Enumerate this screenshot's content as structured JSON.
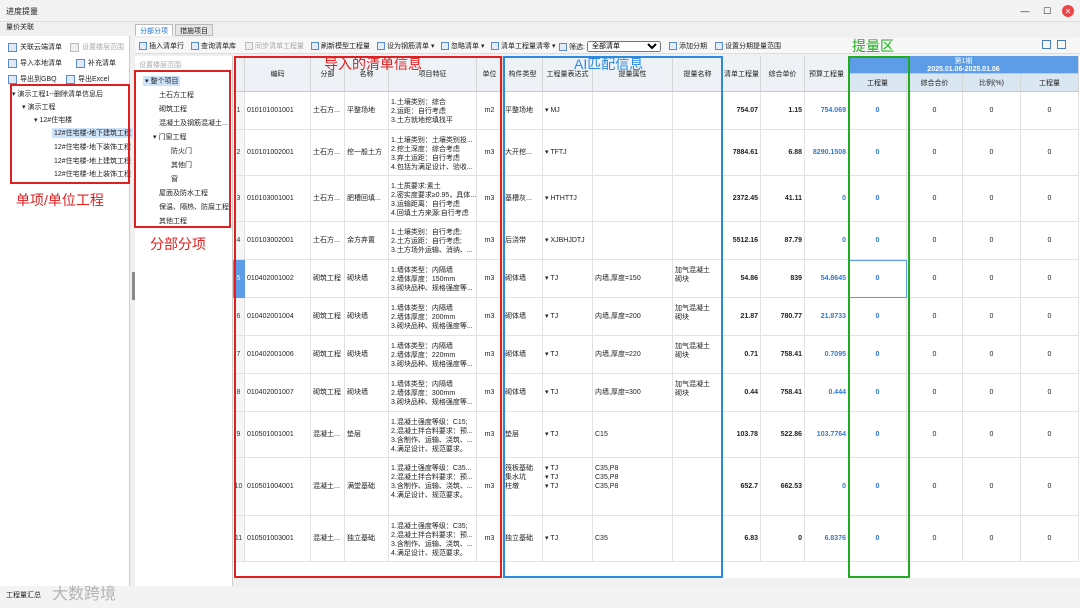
{
  "window": {
    "title": "进度提量",
    "subtitle": "量价关联"
  },
  "tabs": [
    {
      "label": "分部分项"
    },
    {
      "label": "措施项目"
    }
  ],
  "left_buttons": [
    {
      "label": "关联云端清单"
    },
    {
      "label": "设置楼层范围"
    },
    {
      "label": "导入本地清单"
    },
    {
      "label": "补充清单"
    },
    {
      "label": "导出到GBQ"
    },
    {
      "label": "导出Excel"
    }
  ],
  "project_tree": [
    {
      "label": "演示工程1--删除清单信息后"
    },
    {
      "label": "演示工程"
    },
    {
      "label": "12#住宅楼"
    },
    {
      "label": "12#住宅楼-地下建筑工程"
    },
    {
      "label": "12#住宅楼-地下装饰工程"
    },
    {
      "label": "12#住宅楼-地上建筑工程"
    },
    {
      "label": "12#住宅楼-地上装饰工程"
    }
  ],
  "toolbar": {
    "insert_list_row": "插入清单行",
    "query_list_lib": "查询清单库",
    "sync_list_qty": "同步清单工程量",
    "refresh_model_qty": "刷新模型工程量",
    "set_rebar_list": "设为钢筋清单",
    "ignore_list": "忽略清单",
    "list_qty_clear": "清单工程量清零",
    "filter_label": "筛选:",
    "filter_value": "全部清单",
    "add_period": "添加分期",
    "set_period_range": "设置分期提量范围",
    "floor_range": "设置楼层范围"
  },
  "section_tree": [
    {
      "label": "整个项目"
    },
    {
      "label": "土石方工程"
    },
    {
      "label": "砌筑工程"
    },
    {
      "label": "混凝土及钢筋混凝土..."
    },
    {
      "label": "门窗工程"
    },
    {
      "label": "防火门"
    },
    {
      "label": "其他门"
    },
    {
      "label": "窗"
    },
    {
      "label": "屋面及防水工程"
    },
    {
      "label": "保温、隔热、防腐工程"
    },
    {
      "label": "其他工程"
    }
  ],
  "columns": {
    "code": "编码",
    "division": "分部",
    "name": "名称",
    "features": "项目特征",
    "unit": "单位",
    "component_type": "构件类型",
    "expression": "工程量表达式",
    "attribute": "提量属性",
    "attr_name": "提量名称",
    "list_qty": "清单工程量",
    "unit_price": "综合单价",
    "budget_qty": "预算工程量",
    "period_title": "第1期",
    "period_range": "2025.01.06-2025.01.06",
    "period_qty": "工程量",
    "period_total": "综合合价",
    "period_ratio": "比例(%)",
    "period_qty2": "工程量"
  },
  "rows": [
    {
      "no": "1",
      "code": "010101001001",
      "division": "土石方...",
      "name": "平整场地",
      "features": "1.土壤类别：综合\n2.运距：自行考虑\n3.土方就地挖填找平",
      "unit": "m2",
      "ctype": "平整场地",
      "expr": "MJ",
      "attr": "",
      "attrname": "",
      "list_qty": "754.07",
      "price": "1.15",
      "budget": "754.069",
      "pqty": "0",
      "ptotal": "0",
      "pratio": "0",
      "pqty2": "0"
    },
    {
      "no": "2",
      "code": "010101002001",
      "division": "土石方...",
      "name": "挖一般土方",
      "features": "1.土壤类别：土壤类别投...\n2.挖土深度：综合考虑\n3.弃土运距：自行考虑\n4.包括为满足设计、验收...",
      "unit": "m3",
      "ctype": "大开挖...",
      "expr": "TFTJ",
      "attr": "",
      "attrname": "",
      "list_qty": "7884.61",
      "price": "6.88",
      "budget": "8290.1508",
      "pqty": "0",
      "ptotal": "0",
      "pratio": "0",
      "pqty2": "0"
    },
    {
      "no": "3",
      "code": "010103001001",
      "division": "土石方...",
      "name": "肥槽回填...",
      "features": "1.土质要求:素土\n2.密实度要求≥0.95，具体...\n3.运输距离：自行考虑\n4.回填土方来源:自行考虑",
      "unit": "m3",
      "ctype": "基槽灰...",
      "expr": "HTHTTJ",
      "attr": "",
      "attrname": "",
      "list_qty": "2372.45",
      "price": "41.11",
      "budget": "0",
      "pqty": "0",
      "ptotal": "0",
      "pratio": "0",
      "pqty2": "0"
    },
    {
      "no": "4",
      "code": "010103002001",
      "division": "土石方...",
      "name": "余方弃置",
      "features": "1.土壤类别：自行考虑;\n2.土方运距：自行考虑;\n3.土方场外运输、消纳、...",
      "unit": "m3",
      "ctype": "后浇带",
      "expr": "XJBHJDTJ",
      "attr": "",
      "attrname": "",
      "list_qty": "5512.16",
      "price": "87.79",
      "budget": "0",
      "pqty": "0",
      "ptotal": "0",
      "pratio": "0",
      "pqty2": "0"
    },
    {
      "no": "5",
      "code": "010402001002",
      "division": "砌筑工程",
      "name": "砌块墙",
      "features": "1.墙体类型：内隔墙\n2.墙体厚度：150mm\n3.砌块品种、规格强度等...",
      "unit": "m3",
      "ctype": "砌体墙",
      "expr": "TJ",
      "attr": "内墙,厚度=150",
      "attrname": "加气混凝土\n砌块",
      "list_qty": "54.86",
      "price": "839",
      "budget": "54.8645",
      "pqty": "0",
      "ptotal": "0",
      "pratio": "0",
      "pqty2": "0"
    },
    {
      "no": "6",
      "code": "010402001004",
      "division": "砌筑工程",
      "name": "砌块墙",
      "features": "1.墙体类型：内隔墙\n2.墙体厚度：200mm\n3.砌块品种、规格强度等...",
      "unit": "m3",
      "ctype": "砌体墙",
      "expr": "TJ",
      "attr": "内墙,厚度=200",
      "attrname": "加气混凝土\n砌块",
      "list_qty": "21.87",
      "price": "780.77",
      "budget": "21.8733",
      "pqty": "0",
      "ptotal": "0",
      "pratio": "0",
      "pqty2": "0"
    },
    {
      "no": "7",
      "code": "010402001006",
      "division": "砌筑工程",
      "name": "砌块墙",
      "features": "1.墙体类型：内隔墙\n2.墙体厚度：220mm\n3.砌块品种、规格强度等...",
      "unit": "m3",
      "ctype": "砌体墙",
      "expr": "TJ",
      "attr": "内墙,厚度=220",
      "attrname": "加气混凝土\n砌块",
      "list_qty": "0.71",
      "price": "758.41",
      "budget": "0.7095",
      "pqty": "0",
      "ptotal": "0",
      "pratio": "0",
      "pqty2": "0"
    },
    {
      "no": "8",
      "code": "010402001007",
      "division": "砌筑工程",
      "name": "砌块墙",
      "features": "1.墙体类型：内隔墙\n2.墙体厚度：300mm\n3.砌块品种、规格强度等...",
      "unit": "m3",
      "ctype": "砌体墙",
      "expr": "TJ",
      "attr": "内墙,厚度=300",
      "attrname": "加气混凝土\n砌块",
      "list_qty": "0.44",
      "price": "758.41",
      "budget": "0.444",
      "pqty": "0",
      "ptotal": "0",
      "pratio": "0",
      "pqty2": "0"
    },
    {
      "no": "9",
      "code": "010501001001",
      "division": "混凝土...",
      "name": "垫层",
      "features": "1.混凝土强度等级：C15;\n2.混凝土拌合料要求：预...\n3.含制作、运输、浇筑、...\n4.满足设计、规范要求。",
      "unit": "m3",
      "ctype": "垫层",
      "expr": "TJ",
      "attr": "C15",
      "attrname": "",
      "list_qty": "103.78",
      "price": "522.86",
      "budget": "103.7764",
      "pqty": "0",
      "ptotal": "0",
      "pratio": "0",
      "pqty2": "0"
    },
    {
      "no": "10",
      "code": "010501004001",
      "division": "混凝土...",
      "name": "满堂基础",
      "features": "1.混凝土强度等级：C35...\n2.混凝土拌合料要求：预...\n3.含制作、运输、浇筑、...\n4.满足设计、规范要求。",
      "unit": "m3",
      "ctype": "筏板基础\n集水坑\n柱墩",
      "expr": "TJ\nTJ\nTJ",
      "attr": "C35,P8\nC35,P8\nC35,P8",
      "attrname": "",
      "list_qty": "652.7",
      "price": "662.53",
      "budget": "0",
      "pqty": "0",
      "ptotal": "0",
      "pratio": "0",
      "pqty2": "0"
    },
    {
      "no": "11",
      "code": "010501003001",
      "division": "混凝土...",
      "name": "独立基础",
      "features": "1.混凝土强度等级：C35;\n2.混凝土拌合料要求：预...\n3.含制作、运输、浇筑、...\n4.满足设计、规范要求。",
      "unit": "m3",
      "ctype": "独立基础",
      "expr": "TJ",
      "attr": "C35",
      "attrname": "",
      "list_qty": "6.83",
      "price": "0",
      "budget": "6.8376",
      "pqty": "0",
      "ptotal": "0",
      "pratio": "0",
      "pqty2": "0"
    }
  ],
  "annotations": {
    "imported_list": "导入的清单信息",
    "ai_match": "AI匹配信息",
    "qty_area": "提量区",
    "unit_project": "单项/单位工程",
    "section_items": "分部分项"
  },
  "bottom": {
    "status": "工程量汇总"
  },
  "watermark": "大数跨境",
  "colors": {
    "red": "#e02020",
    "blue": "#2b8ae0",
    "green": "#22aa22",
    "accent": "#5d9ce6"
  }
}
